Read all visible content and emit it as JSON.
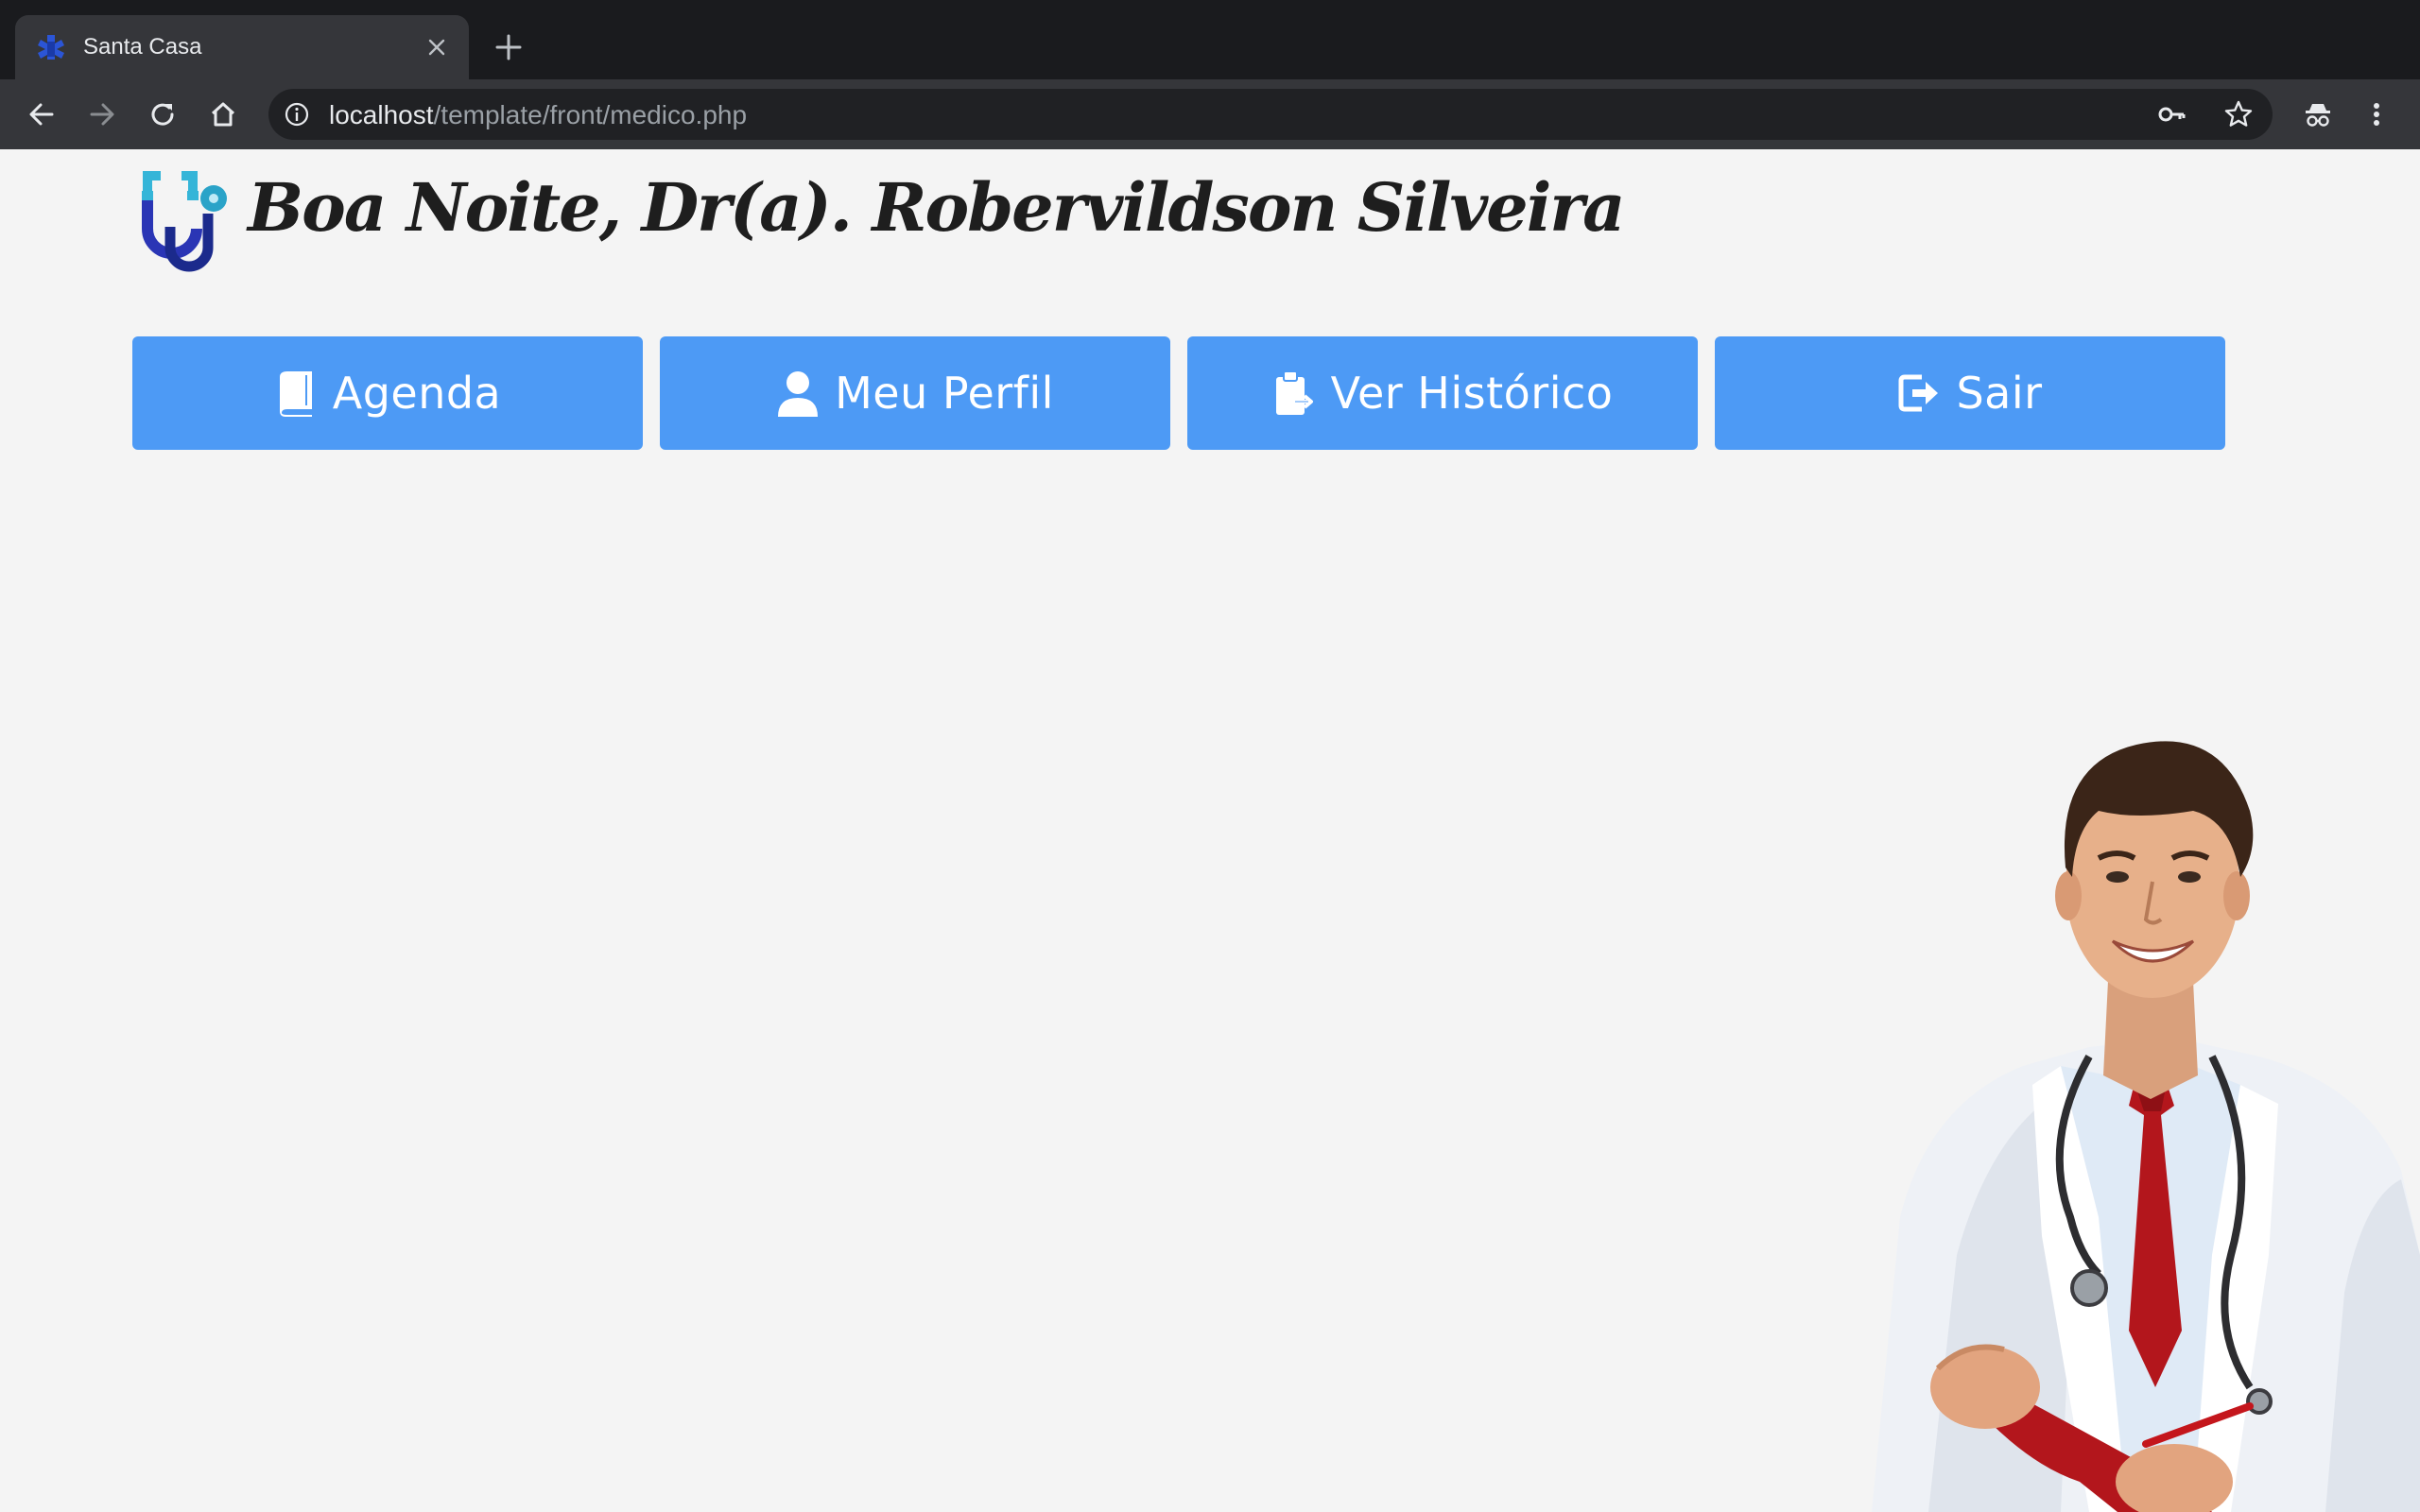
{
  "browser": {
    "tab_title": "Santa Casa",
    "url_host": "localhost",
    "url_path": "/template/front/medico.php"
  },
  "page": {
    "greeting": "Boa Noite, Dr(a). Robervildson Silveira",
    "accent_color": "#4d9af5",
    "nav": [
      {
        "label": "Agenda",
        "icon": "book-icon"
      },
      {
        "label": "Meu Perfil",
        "icon": "user-icon"
      },
      {
        "label": "Ver Histórico",
        "icon": "clipboard-icon"
      },
      {
        "label": "Sair",
        "icon": "logout-icon"
      }
    ]
  }
}
